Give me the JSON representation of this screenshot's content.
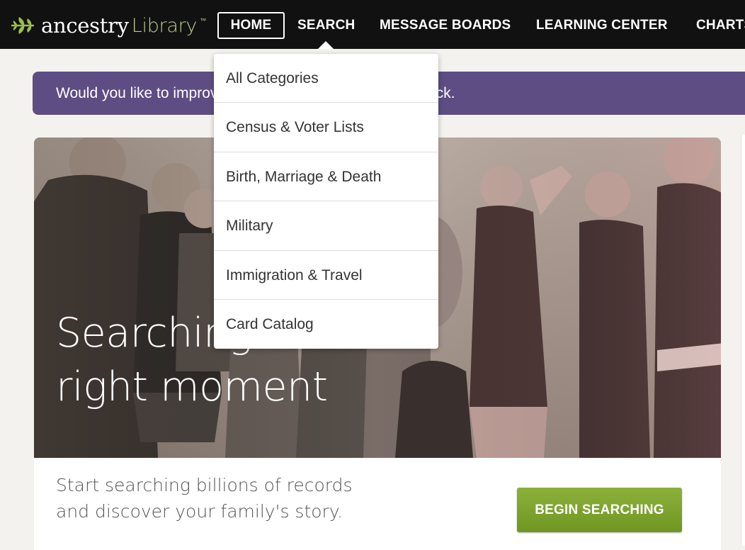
{
  "logo": {
    "brand": "ancestry",
    "product": "Library",
    "tm": "™"
  },
  "nav": {
    "home": "HOME",
    "search": "SEARCH",
    "message_boards": "MESSAGE BOARDS",
    "learning_center": "LEARNING CENTER",
    "charts": "CHARTS"
  },
  "feedback": {
    "text": "Would you like to improve this page? Give us your feedback."
  },
  "search_menu": {
    "items": [
      "All Categories",
      "Census & Voter Lists",
      "Birth, Marriage & Death",
      "Military",
      "Immigration & Travel",
      "Card Catalog"
    ]
  },
  "hero": {
    "line1": "Searching for that",
    "line2": "right moment"
  },
  "promo": {
    "text": "Start searching billions of records and discover your family's story.",
    "button": "BEGIN SEARCHING"
  },
  "colors": {
    "nav_bg": "#111111",
    "feedback_bg": "#5e4d83",
    "button_green": "#7da22e",
    "logo_leaf": "#9bbf4a"
  },
  "icons": {
    "logo": "leaf-icon"
  }
}
